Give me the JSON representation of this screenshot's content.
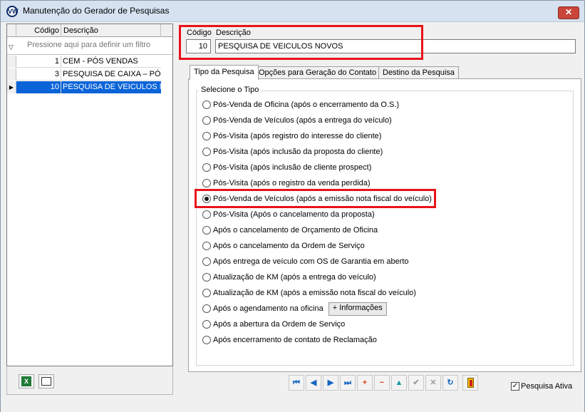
{
  "window": {
    "title": "Manutenção do Gerador de Pesquisas",
    "app_icon": "VW",
    "close_label": "✕"
  },
  "grid": {
    "col_code": "Código",
    "col_desc": "Descrição",
    "filter_placeholder": "Pressione aqui para definir um filtro",
    "rows": [
      {
        "code": "1",
        "desc": "CEM - PÓS VENDAS"
      },
      {
        "code": "3",
        "desc": "PESQUISA DE CAIXA – PÓS"
      },
      {
        "code": "10",
        "desc": "PESQUISA DE VEICULOS NO"
      }
    ]
  },
  "header": {
    "code_label": "Código",
    "desc_label": "Descrição",
    "code_value": "10",
    "desc_value": "PESQUISA DE VEICULOS NOVOS"
  },
  "tabs": [
    "Tipo da Pesquisa",
    "Opções para Geração do Contato",
    "Destino da Pesquisa"
  ],
  "type_group": {
    "title": "Selecione o Tipo",
    "options": [
      "Pós-Venda de Oficina (após o encerramento da O.S.)",
      "Pós-Venda de Veículos (após a entrega do veículo)",
      "Pós-Visita (após registro do interesse do cliente)",
      "Pós-Visita (após inclusão da proposta do cliente)",
      "Pós-Visita (após inclusão de cliente prospect)",
      "Pós-Visita (após o registro da venda perdida)",
      "Pós-Venda de Veículos (após a emissão nota fiscal do veículo)",
      "Pós-Visita (Após o cancelamento da proposta)",
      "Após o cancelamento de Orçamento de Oficina",
      "Após o cancelamento da Ordem de Serviço",
      "Após entrega de veículo com OS de Garantia em aberto",
      "Atualização de KM (após a entrega do veículo)",
      "Atualização de KM (após a emissão nota fiscal do veículo)",
      "Após o agendamento na oficina",
      "Após a abertura da Ordem de Serviço",
      "Após encerramento de contato de Reclamação"
    ],
    "selected_index": 6,
    "info_button": "+ Informações"
  },
  "navigator": {
    "first": "⏮",
    "prior": "◀",
    "next": "▶",
    "last": "⏭",
    "insert": "+",
    "delete": "−",
    "edit": "▲",
    "post": "✔",
    "cancel": "✕",
    "refresh": "↻"
  },
  "footer": {
    "active_label": "Pesquisa Ativa",
    "active_checked": true
  },
  "colors": {
    "highlight": "#e8121c",
    "selection": "#0a64d8"
  }
}
